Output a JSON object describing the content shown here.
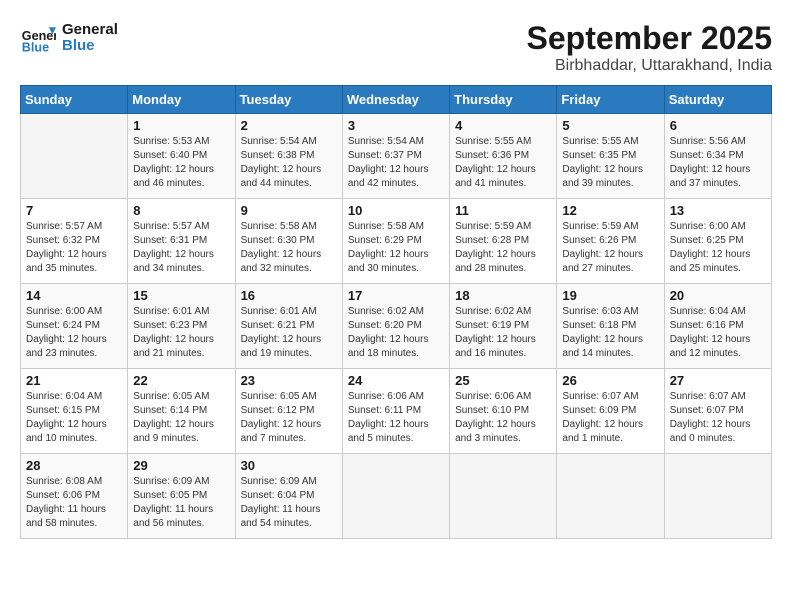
{
  "logo": {
    "line1": "General",
    "line2": "Blue"
  },
  "title": "September 2025",
  "location": "Birbhaddar, Uttarakhand, India",
  "days_of_week": [
    "Sunday",
    "Monday",
    "Tuesday",
    "Wednesday",
    "Thursday",
    "Friday",
    "Saturday"
  ],
  "weeks": [
    [
      {
        "day": "",
        "detail": ""
      },
      {
        "day": "1",
        "detail": "Sunrise: 5:53 AM\nSunset: 6:40 PM\nDaylight: 12 hours\nand 46 minutes."
      },
      {
        "day": "2",
        "detail": "Sunrise: 5:54 AM\nSunset: 6:38 PM\nDaylight: 12 hours\nand 44 minutes."
      },
      {
        "day": "3",
        "detail": "Sunrise: 5:54 AM\nSunset: 6:37 PM\nDaylight: 12 hours\nand 42 minutes."
      },
      {
        "day": "4",
        "detail": "Sunrise: 5:55 AM\nSunset: 6:36 PM\nDaylight: 12 hours\nand 41 minutes."
      },
      {
        "day": "5",
        "detail": "Sunrise: 5:55 AM\nSunset: 6:35 PM\nDaylight: 12 hours\nand 39 minutes."
      },
      {
        "day": "6",
        "detail": "Sunrise: 5:56 AM\nSunset: 6:34 PM\nDaylight: 12 hours\nand 37 minutes."
      }
    ],
    [
      {
        "day": "7",
        "detail": "Sunrise: 5:57 AM\nSunset: 6:32 PM\nDaylight: 12 hours\nand 35 minutes."
      },
      {
        "day": "8",
        "detail": "Sunrise: 5:57 AM\nSunset: 6:31 PM\nDaylight: 12 hours\nand 34 minutes."
      },
      {
        "day": "9",
        "detail": "Sunrise: 5:58 AM\nSunset: 6:30 PM\nDaylight: 12 hours\nand 32 minutes."
      },
      {
        "day": "10",
        "detail": "Sunrise: 5:58 AM\nSunset: 6:29 PM\nDaylight: 12 hours\nand 30 minutes."
      },
      {
        "day": "11",
        "detail": "Sunrise: 5:59 AM\nSunset: 6:28 PM\nDaylight: 12 hours\nand 28 minutes."
      },
      {
        "day": "12",
        "detail": "Sunrise: 5:59 AM\nSunset: 6:26 PM\nDaylight: 12 hours\nand 27 minutes."
      },
      {
        "day": "13",
        "detail": "Sunrise: 6:00 AM\nSunset: 6:25 PM\nDaylight: 12 hours\nand 25 minutes."
      }
    ],
    [
      {
        "day": "14",
        "detail": "Sunrise: 6:00 AM\nSunset: 6:24 PM\nDaylight: 12 hours\nand 23 minutes."
      },
      {
        "day": "15",
        "detail": "Sunrise: 6:01 AM\nSunset: 6:23 PM\nDaylight: 12 hours\nand 21 minutes."
      },
      {
        "day": "16",
        "detail": "Sunrise: 6:01 AM\nSunset: 6:21 PM\nDaylight: 12 hours\nand 19 minutes."
      },
      {
        "day": "17",
        "detail": "Sunrise: 6:02 AM\nSunset: 6:20 PM\nDaylight: 12 hours\nand 18 minutes."
      },
      {
        "day": "18",
        "detail": "Sunrise: 6:02 AM\nSunset: 6:19 PM\nDaylight: 12 hours\nand 16 minutes."
      },
      {
        "day": "19",
        "detail": "Sunrise: 6:03 AM\nSunset: 6:18 PM\nDaylight: 12 hours\nand 14 minutes."
      },
      {
        "day": "20",
        "detail": "Sunrise: 6:04 AM\nSunset: 6:16 PM\nDaylight: 12 hours\nand 12 minutes."
      }
    ],
    [
      {
        "day": "21",
        "detail": "Sunrise: 6:04 AM\nSunset: 6:15 PM\nDaylight: 12 hours\nand 10 minutes."
      },
      {
        "day": "22",
        "detail": "Sunrise: 6:05 AM\nSunset: 6:14 PM\nDaylight: 12 hours\nand 9 minutes."
      },
      {
        "day": "23",
        "detail": "Sunrise: 6:05 AM\nSunset: 6:12 PM\nDaylight: 12 hours\nand 7 minutes."
      },
      {
        "day": "24",
        "detail": "Sunrise: 6:06 AM\nSunset: 6:11 PM\nDaylight: 12 hours\nand 5 minutes."
      },
      {
        "day": "25",
        "detail": "Sunrise: 6:06 AM\nSunset: 6:10 PM\nDaylight: 12 hours\nand 3 minutes."
      },
      {
        "day": "26",
        "detail": "Sunrise: 6:07 AM\nSunset: 6:09 PM\nDaylight: 12 hours\nand 1 minute."
      },
      {
        "day": "27",
        "detail": "Sunrise: 6:07 AM\nSunset: 6:07 PM\nDaylight: 12 hours\nand 0 minutes."
      }
    ],
    [
      {
        "day": "28",
        "detail": "Sunrise: 6:08 AM\nSunset: 6:06 PM\nDaylight: 11 hours\nand 58 minutes."
      },
      {
        "day": "29",
        "detail": "Sunrise: 6:09 AM\nSunset: 6:05 PM\nDaylight: 11 hours\nand 56 minutes."
      },
      {
        "day": "30",
        "detail": "Sunrise: 6:09 AM\nSunset: 6:04 PM\nDaylight: 11 hours\nand 54 minutes."
      },
      {
        "day": "",
        "detail": ""
      },
      {
        "day": "",
        "detail": ""
      },
      {
        "day": "",
        "detail": ""
      },
      {
        "day": "",
        "detail": ""
      }
    ]
  ]
}
